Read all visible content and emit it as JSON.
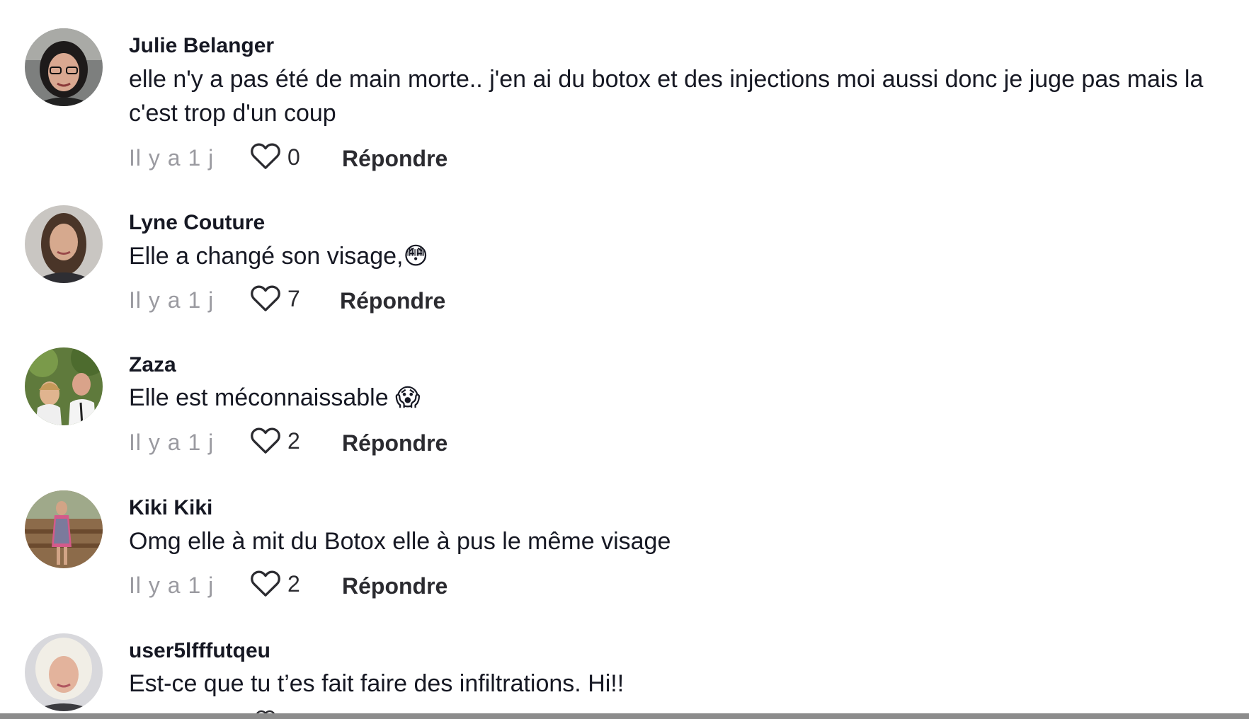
{
  "comments": [
    {
      "username": "Julie Belanger",
      "text": "elle n'y a pas été de main morte.. j'en ai du botox et des injections moi aussi donc je juge pas mais la c'est trop d'un coup",
      "time": "Il y a 1 j",
      "likes": "0",
      "reply_label": "Répondre"
    },
    {
      "username": "Lyne Couture",
      "text": "Elle a changé son visage,",
      "emoji": "😳",
      "time": "Il y a 1 j",
      "likes": "7",
      "reply_label": "Répondre"
    },
    {
      "username": "Zaza",
      "text": "Elle est méconnaissable ",
      "emoji": "😱",
      "time": "Il y a 1 j",
      "likes": "2",
      "reply_label": "Répondre"
    },
    {
      "username": "Kiki Kiki",
      "text": "Omg elle à mit du Botox elle à pus le même visage",
      "time": "Il y a 1 j",
      "likes": "2",
      "reply_label": "Répondre"
    },
    {
      "username": "user5lfffutqeu",
      "text": "Est-ce que tu t’es fait faire des infiltrations. Hi!!"
    }
  ],
  "colors": {
    "text_primary": "#161823",
    "text_secondary": "#9a9aa0",
    "background": "#ffffff"
  }
}
